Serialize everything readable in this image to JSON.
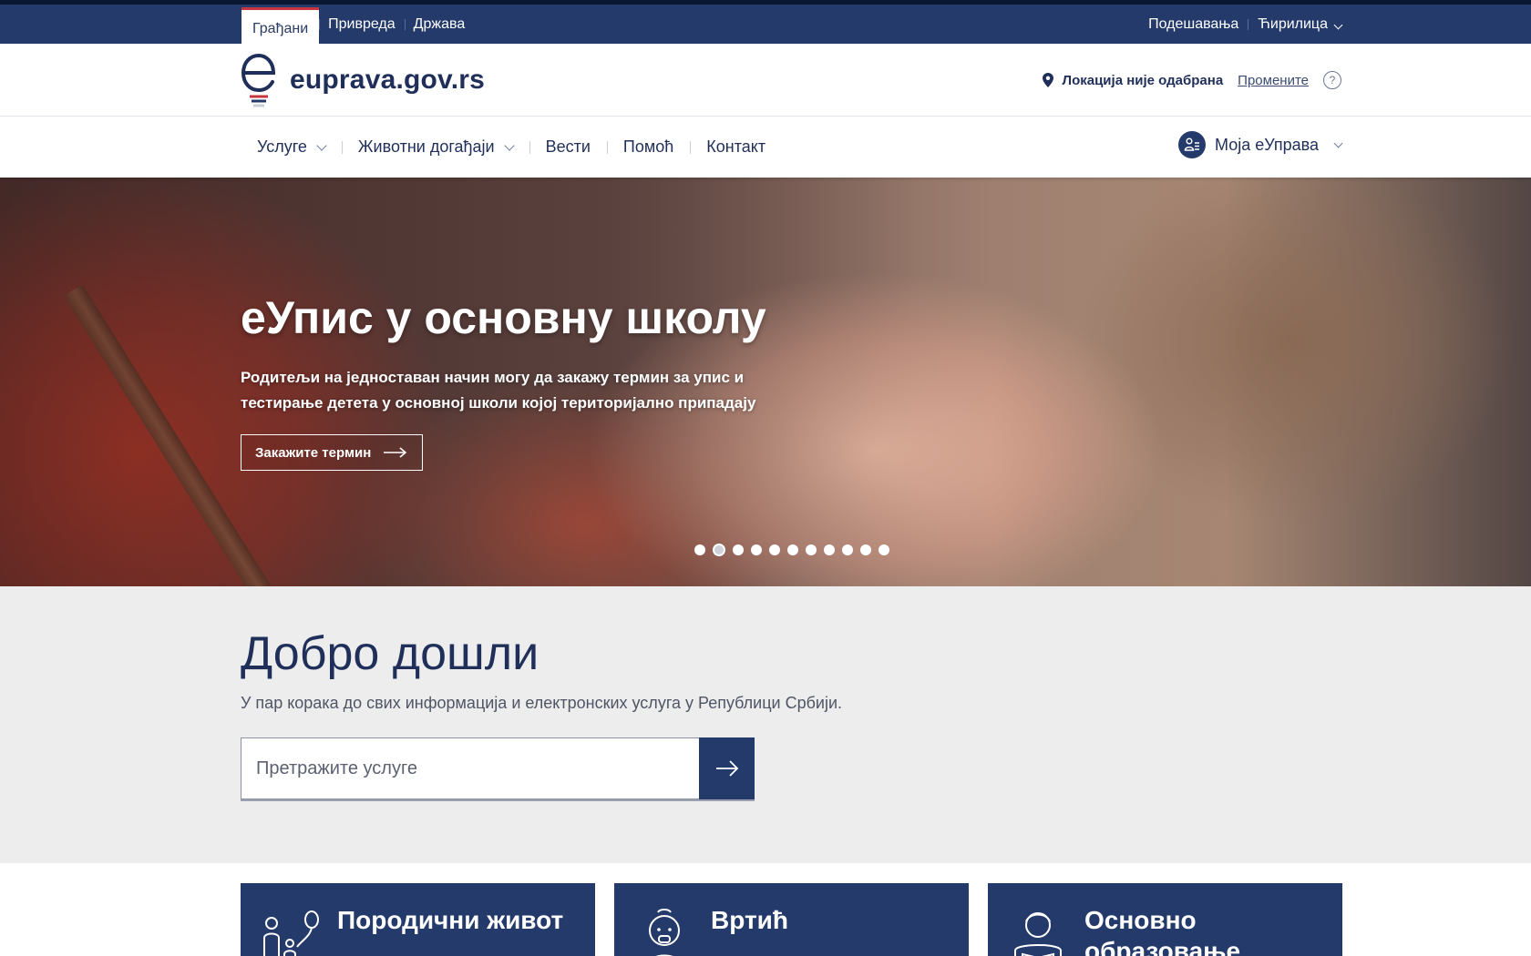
{
  "topbar": {
    "tabs": [
      {
        "label": "Грађани",
        "active": true
      },
      {
        "label": "Привреда"
      },
      {
        "label": "Држава"
      }
    ],
    "settings": "Подешавања",
    "script": "Ћирилица"
  },
  "header": {
    "logo_text": "euprava.gov.rs",
    "location_label": "Локација није одабрана",
    "change_label": "Промените",
    "help_glyph": "?"
  },
  "nav": {
    "items": [
      {
        "label": "Услуге",
        "dropdown": true
      },
      {
        "label": "Животни догађаји",
        "dropdown": true
      },
      {
        "label": "Вести"
      },
      {
        "label": "Помоћ"
      },
      {
        "label": "Контакт"
      }
    ],
    "account_label": "Моја еУправа"
  },
  "hero": {
    "title": "еУпис у основну школу",
    "text": "Родитељи на једноставан начин могу да закажу термин за упис и тестирање детета у основној школи којој територијално припадају",
    "button_label": "Закажите термин",
    "slides": 11,
    "active_slide": 2
  },
  "welcome": {
    "title": "Добро дошли",
    "subtitle": "У пар корака до свих информација и електронских услуга у Републици Србији.",
    "search_placeholder": "Претражите услуге"
  },
  "cards": [
    {
      "title": "Породични живот",
      "icon": "family-icon"
    },
    {
      "title": "Вртић",
      "icon": "child-icon"
    },
    {
      "title": "Основно образовање",
      "icon": "student-icon"
    }
  ],
  "colors": {
    "brand_navy": "#243a6b",
    "accent_red": "#c6363c",
    "welcome_bg": "#ededed"
  }
}
